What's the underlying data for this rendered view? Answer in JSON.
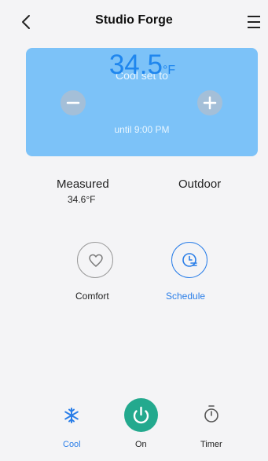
{
  "header": {
    "title": "Studio Forge"
  },
  "thermostat": {
    "mode_label": "Cool set to",
    "setpoint": "34.5",
    "unit": "°F",
    "until": "until 9:00 PM"
  },
  "readings": {
    "measured_label": "Measured",
    "measured_value": "34.6°F",
    "outdoor_label": "Outdoor"
  },
  "presets": {
    "comfort_label": "Comfort",
    "schedule_label": "Schedule"
  },
  "bottom_bar": {
    "cool_label": "Cool",
    "on_label": "On",
    "timer_label": "Timer"
  },
  "colors": {
    "card": "#7cc2f8",
    "accent": "#2a7ee8",
    "power": "#23a98e"
  }
}
